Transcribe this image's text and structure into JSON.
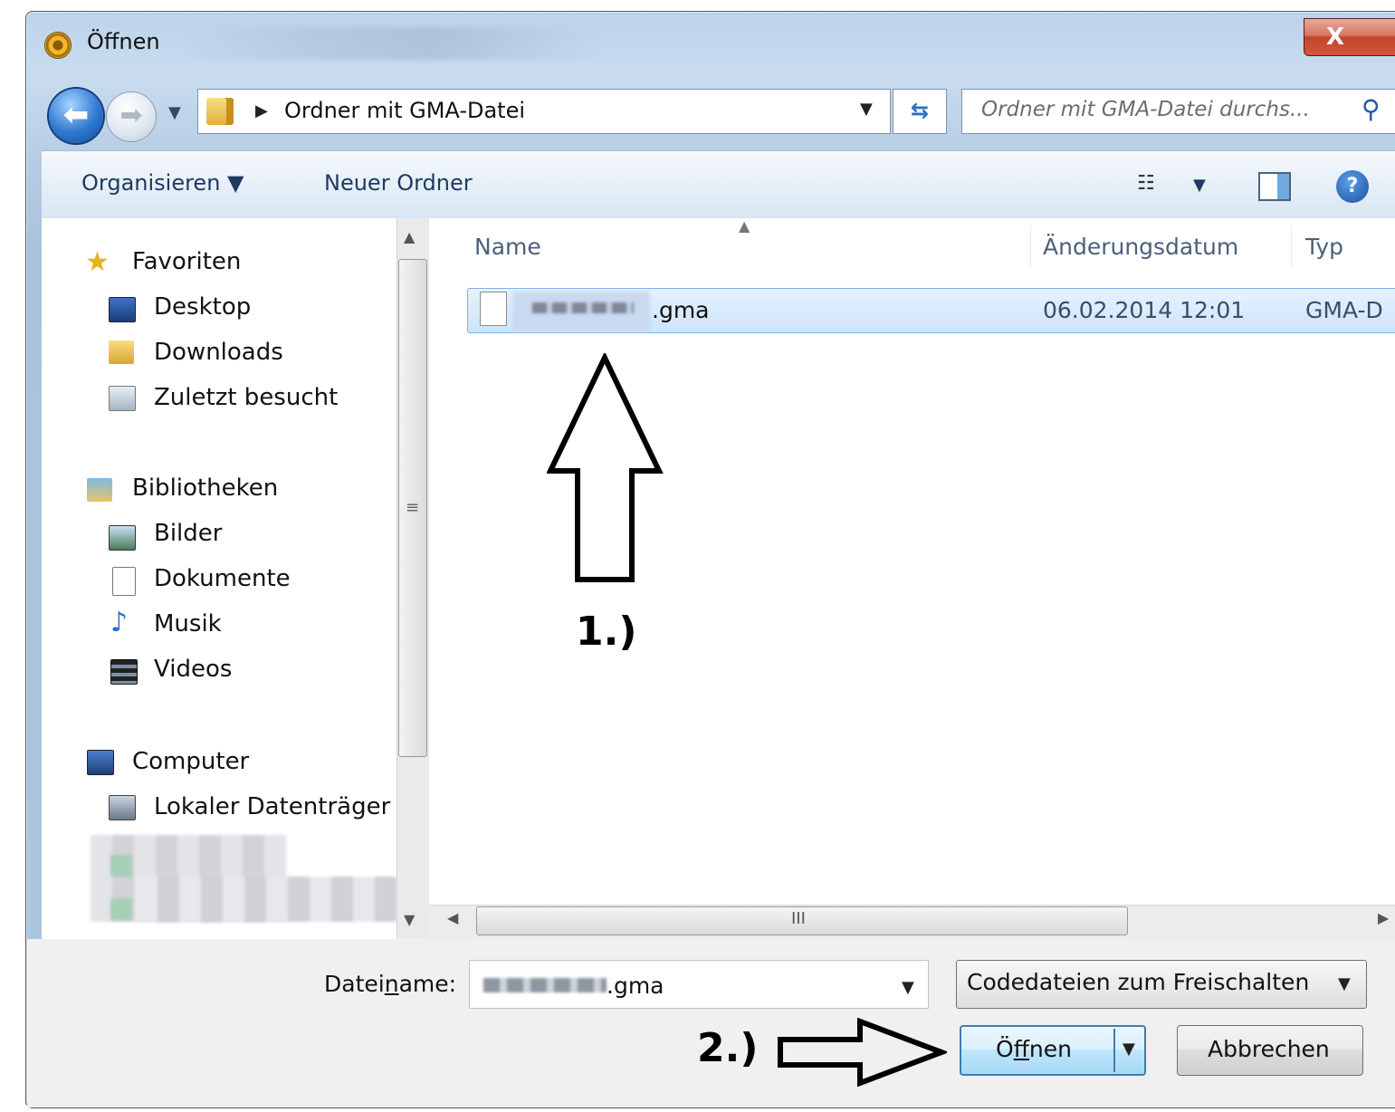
{
  "window": {
    "title": "Öffnen",
    "close_label": "X"
  },
  "address_bar": {
    "path_label": "Ordner mit GMA-Datei",
    "search_placeholder": "Ordner mit GMA-Datei durchs..."
  },
  "toolbar": {
    "organise_label": "Organisieren ▼",
    "new_folder_label": "Neuer Ordner"
  },
  "navigation": {
    "favorites": {
      "label": "Favoriten",
      "items": [
        "Desktop",
        "Downloads",
        "Zuletzt besucht"
      ]
    },
    "libraries": {
      "label": "Bibliotheken",
      "items": [
        "Bilder",
        "Dokumente",
        "Musik",
        "Videos"
      ]
    },
    "computer": {
      "label": "Computer",
      "items": [
        "Lokaler Datenträger ("
      ]
    }
  },
  "file_list": {
    "columns": [
      "Name",
      "Änderungsdatum",
      "Typ"
    ],
    "rows": [
      {
        "name_suffix": ".gma",
        "date": "06.02.2014 12:01",
        "type": "GMA-D"
      }
    ]
  },
  "footer": {
    "filename_label_pre": "Datei",
    "filename_label_underlined": "n",
    "filename_label_post": "ame:",
    "filename_suffix": ".gma",
    "filter_value": "Codedateien zum Freischalten (",
    "open_label_pre": "Ö",
    "open_label_underlined": "f",
    "open_label_post": "fnen",
    "cancel_label": "Abbrechen"
  },
  "annotations": {
    "step1": "1.)",
    "step2": "2.)"
  },
  "colors": {
    "selection": "#cde4fa",
    "selection_border": "#7fb0e3",
    "accent": "#3c7fb1"
  }
}
